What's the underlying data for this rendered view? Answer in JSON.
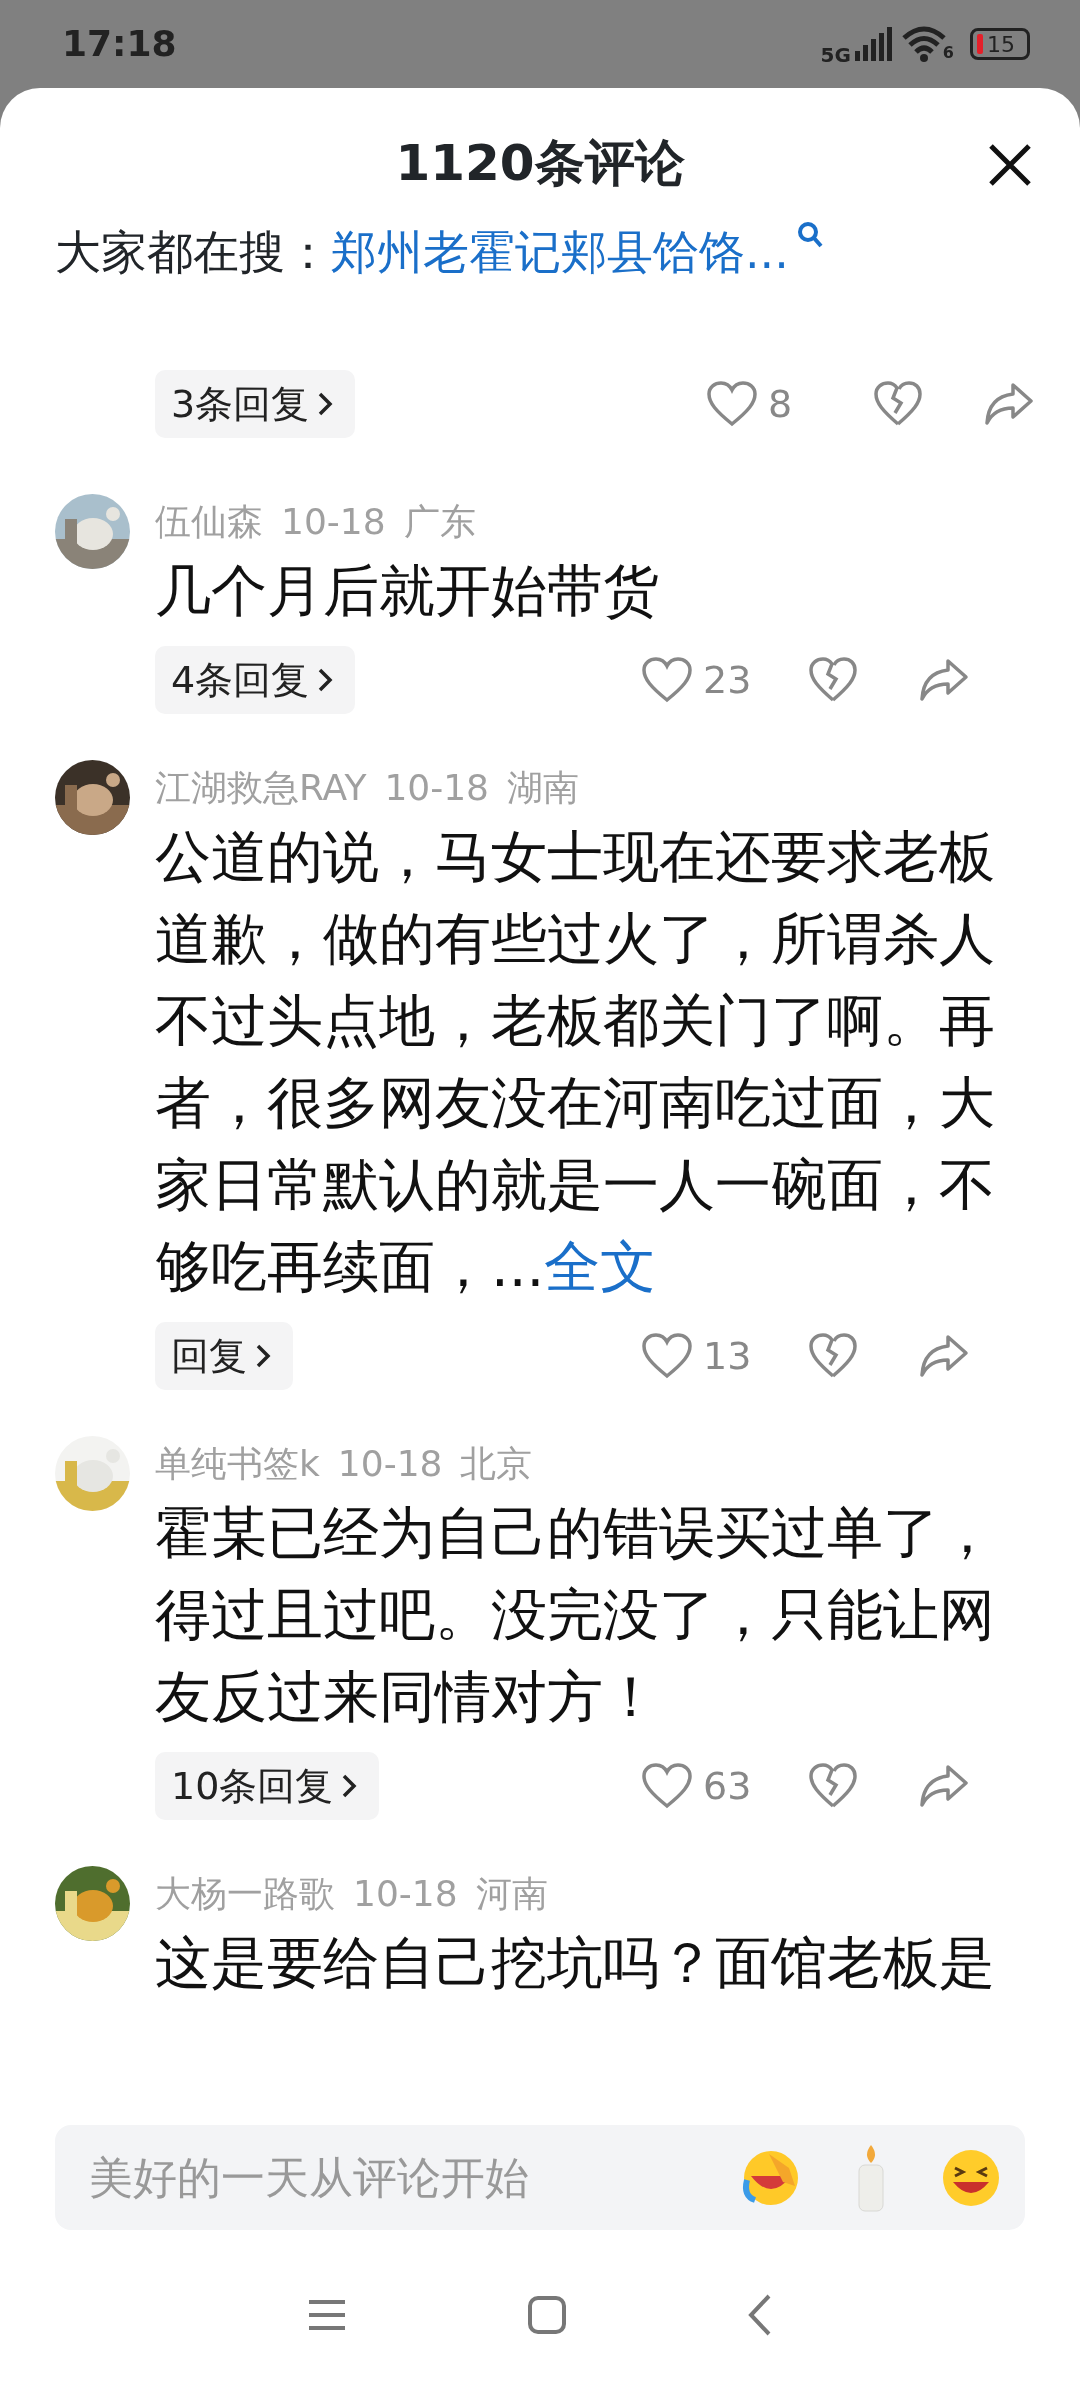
{
  "status_bar": {
    "time": "17:18",
    "network": "5G",
    "wifi_badge": "6",
    "battery": "15"
  },
  "header": {
    "title": "1120条评论"
  },
  "trending": {
    "label": "大家都在搜：",
    "query": "郑州老霍记郏县饸饹..."
  },
  "comments": [
    {
      "kind": "partial",
      "replies": "3条回复",
      "likes": "8"
    },
    {
      "kind": "full",
      "author": "伍仙森",
      "date": "10-18",
      "region": "广东",
      "text": "几个月后就开始带货",
      "replies": "4条回复",
      "likes": "23"
    },
    {
      "kind": "full",
      "author": "江湖救急RAY",
      "date": "10-18",
      "region": "湖南",
      "text": "公道的说，马女士现在还要求老板道歉，做的有些过火了，所谓杀人不过头点地，老板都关门了啊。再者，很多网友没在河南吃过面，大家日常默认的就是一人一碗面，不够吃再续面，...",
      "more": "全文",
      "replies": "回复",
      "likes": "13"
    },
    {
      "kind": "full",
      "author": "单纯书签k",
      "date": "10-18",
      "region": "北京",
      "text": "霍某已经为自己的错误买过单了，得过且过吧。没完没了，只能让网友反过来同情对方！",
      "replies": "10条回复",
      "likes": "63"
    },
    {
      "kind": "full",
      "author": "大杨一路歌",
      "date": "10-18",
      "region": "河南",
      "text": "这是要给自己挖坑吗？面馆老板是"
    }
  ],
  "composer": {
    "placeholder": "美好的一天从评论开始"
  }
}
